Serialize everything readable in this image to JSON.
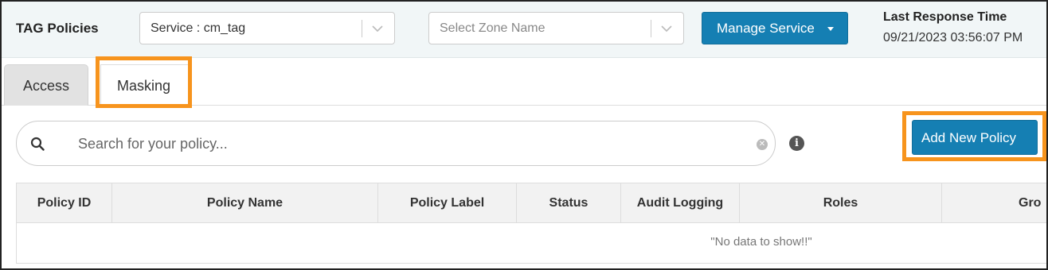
{
  "header": {
    "title": "TAG Policies",
    "service_select": {
      "value": "Service : cm_tag"
    },
    "zone_select": {
      "placeholder": "Select Zone Name"
    },
    "manage_service_label": "Manage Service",
    "last_response_label": "Last Response Time",
    "last_response_value": "09/21/2023 03:56:07 PM"
  },
  "tabs": [
    {
      "label": "Access",
      "active": false
    },
    {
      "label": "Masking",
      "active": true
    }
  ],
  "search": {
    "placeholder": "Search for your policy...",
    "value": ""
  },
  "add_button_label": "Add New Policy",
  "table": {
    "columns": [
      "Policy ID",
      "Policy Name",
      "Policy Label",
      "Status",
      "Audit Logging",
      "Roles",
      "Gro"
    ],
    "empty_message": "\"No data to show!!\""
  },
  "colors": {
    "primary": "#157fb3",
    "highlight": "#f7941d",
    "header_bg": "#f1f6f7"
  }
}
